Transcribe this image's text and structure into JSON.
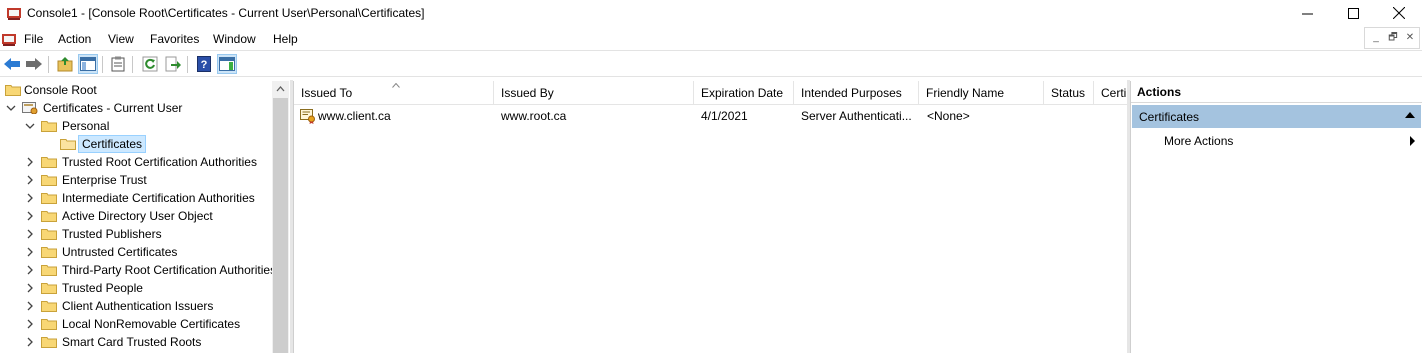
{
  "window": {
    "title": "Console1 - [Console Root\\Certificates - Current User\\Personal\\Certificates]"
  },
  "menu": {
    "items": [
      "File",
      "Action",
      "View",
      "Favorites",
      "Window",
      "Help"
    ]
  },
  "toolbar": {
    "buttons": [
      "back-icon",
      "forward-icon",
      "up-folder-icon",
      "show-hide-tree-icon",
      "clipboard-icon",
      "refresh-icon",
      "export-list-icon",
      "help-icon",
      "show-hide-action-pane-icon"
    ]
  },
  "tree": {
    "root": "Console Root",
    "store": "Certificates - Current User",
    "personal": "Personal",
    "certificates": "Certificates",
    "folders": [
      "Trusted Root Certification Authorities",
      "Enterprise Trust",
      "Intermediate Certification Authorities",
      "Active Directory User Object",
      "Trusted Publishers",
      "Untrusted Certificates",
      "Third-Party Root Certification Authorities",
      "Trusted People",
      "Client Authentication Issuers",
      "Local NonRemovable Certificates",
      "Smart Card Trusted Roots"
    ]
  },
  "list": {
    "columns": [
      "Issued To",
      "Issued By",
      "Expiration Date",
      "Intended Purposes",
      "Friendly Name",
      "Status",
      "Certi"
    ],
    "rows": [
      {
        "issued_to": "www.client.ca",
        "issued_by": "www.root.ca",
        "expiration": "4/1/2021",
        "purposes": "Server Authenticati...",
        "friendly_name": "<None>",
        "status": "",
        "cert": ""
      }
    ]
  },
  "actions": {
    "header": "Actions",
    "section": "Certificates",
    "items": [
      "More Actions"
    ]
  }
}
